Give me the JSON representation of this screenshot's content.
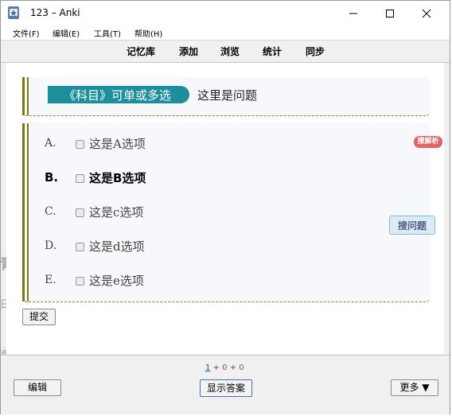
{
  "window": {
    "title": "123 – Anki"
  },
  "menu": [
    "文件(F)",
    "编辑(E)",
    "工具(T)",
    "帮助(H)"
  ],
  "toolbar": [
    "记忆库",
    "添加",
    "浏览",
    "统计",
    "同步"
  ],
  "card": {
    "subject": "《科目》可单或多选",
    "question": "这里是问题",
    "options": [
      {
        "letter": "A.",
        "text": "这是A选项"
      },
      {
        "letter": "B.",
        "text": "这是B选项"
      },
      {
        "letter": "C.",
        "text": "这是c选项"
      },
      {
        "letter": "D.",
        "text": "这是d选项"
      },
      {
        "letter": "E.",
        "text": "这是e选项"
      }
    ],
    "analysis_badge": "搜解析",
    "search_button": "搜问题",
    "submit_button": "提交"
  },
  "bottom": {
    "count_new": "1",
    "count_learn": "0",
    "count_review": "0",
    "edit_button": "编辑",
    "show_answer_button": "显示答案",
    "more_button": "更多 ▼"
  },
  "colors": {
    "subject_bg": "#1d8e9b",
    "left_bar": "#7a7a10",
    "analysis_badge": "#e06666",
    "count_learn": "#c0392b",
    "count_review": "#2e8b57"
  }
}
